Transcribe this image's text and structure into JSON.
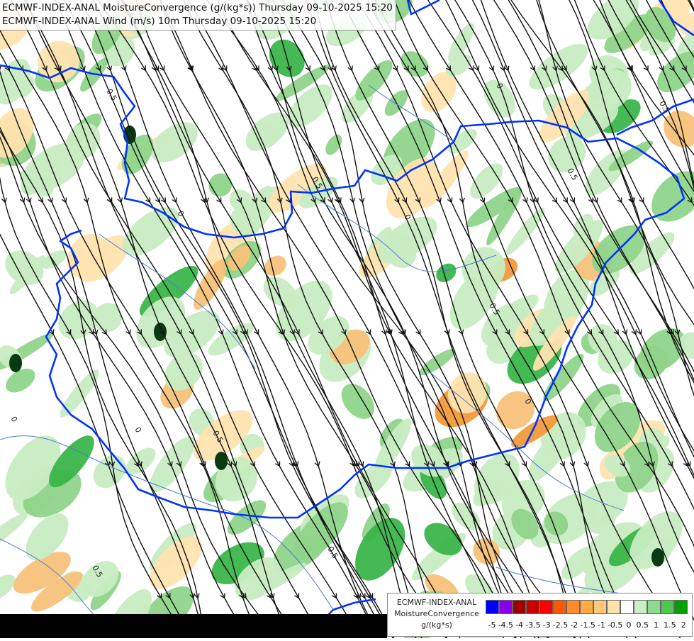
{
  "header": {
    "line1": "ECMWF-INDEX-ANAL MoistureConvergence (g/(kg*s)) Thursday 09-10-2025 15:20",
    "line2": "ECMWF-INDEX-ANAL Wind (m/s) 10m Thursday 09-10-2025 15:20"
  },
  "legend": {
    "model": "ECMWF-INDEX-ANAL",
    "parameter": "MoistureConvergence",
    "unit": "g/(kg*s)",
    "ticks": [
      "-5",
      "-4.5",
      "-4",
      "-3.5",
      "-3",
      "-2.5",
      "-2",
      "-1.5",
      "-1",
      "-0.5",
      "0",
      "0.5",
      "1",
      "1.5",
      "2"
    ],
    "colors": [
      "#0000ff",
      "#8a00e6",
      "#a00000",
      "#c80000",
      "#ff0000",
      "#ff5a00",
      "#ff8c28",
      "#ffaa46",
      "#ffc878",
      "#ffe1aa",
      "#ffffff",
      "#c8f0c8",
      "#8cdc8c",
      "#50c850",
      "#00a000"
    ]
  },
  "map_colors": {
    "border": "#0033ff",
    "river": "#4f7ad6",
    "streamline": "#111111",
    "conv_light": "#c8ecc2",
    "conv_mid": "#8fd48a",
    "conv_strong": "#3bb54a",
    "div_light": "#ffe3b0",
    "div_mid": "#f7c27a",
    "div_strong": "#f29a3c"
  },
  "contour_labels": [
    "0.5",
    "0",
    "0.5",
    "0",
    "0.5",
    "0",
    "0.5",
    "0",
    "-0.5",
    "0.5",
    "0",
    "0.5",
    "0",
    "0.5"
  ]
}
